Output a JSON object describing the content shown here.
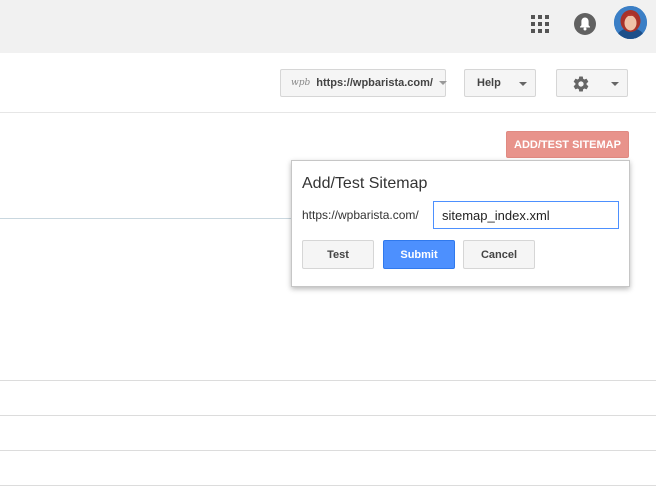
{
  "header": {
    "icons": [
      "apps-icon",
      "notifications-bell-icon",
      "user-avatar"
    ]
  },
  "toolbar": {
    "site_logo_text": "wpb",
    "site_url": "https://wpbarista.com/",
    "help_label": "Help",
    "settings_icon": "gear-icon"
  },
  "actions": {
    "add_sitemap_label": "ADD/TEST SITEMAP"
  },
  "dialog": {
    "title": "Add/Test Sitemap",
    "prefix": "https://wpbarista.com/",
    "input_value": "sitemap_index.xml",
    "buttons": {
      "test": "Test",
      "submit": "Submit",
      "cancel": "Cancel"
    }
  },
  "colors": {
    "accent_blue": "#4d90fe",
    "add_sitemap_button": "#e8938b",
    "topbar_bg": "#f1f1f1"
  }
}
